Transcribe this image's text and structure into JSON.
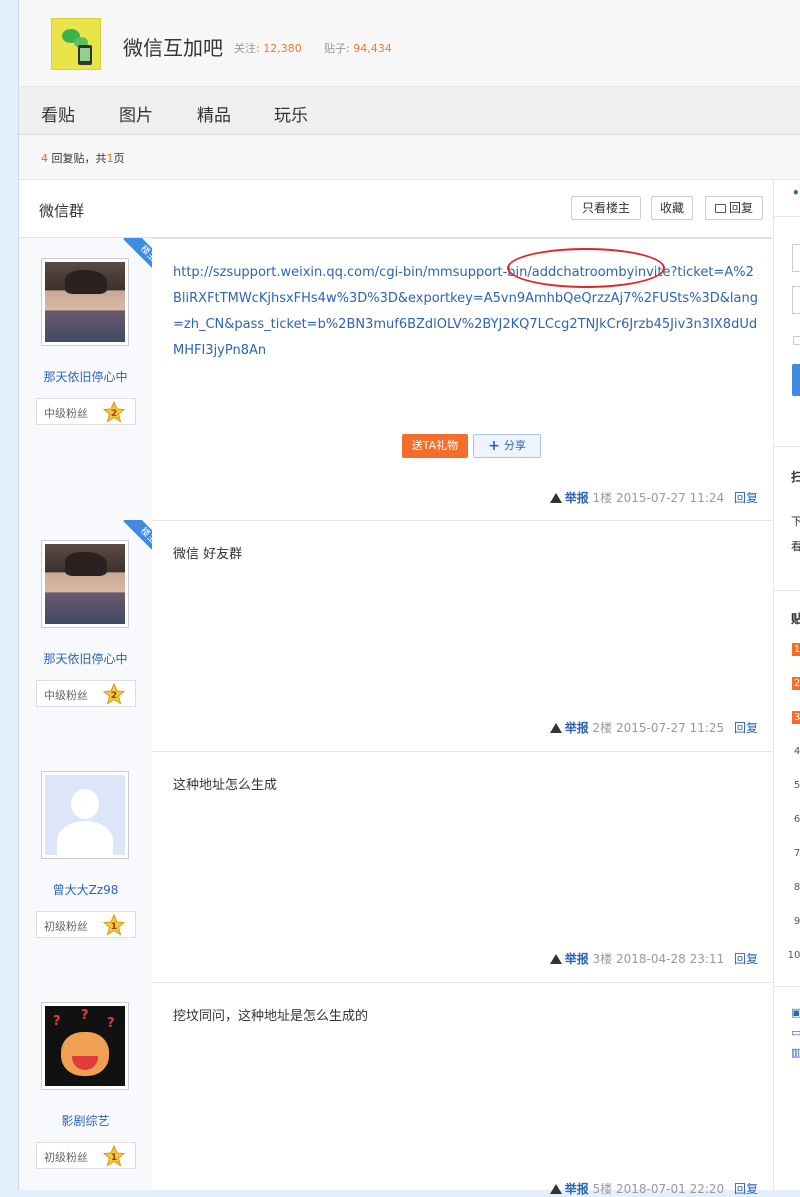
{
  "forum": {
    "name": "微信互加吧",
    "follow_label": "关注:",
    "follow_count": "12,380",
    "posts_label": "贴子:",
    "posts_count": "94,434"
  },
  "nav": [
    "看贴",
    "图片",
    "精品",
    "玩乐"
  ],
  "pager": {
    "replies": "4",
    "replies_text": "回复贴，共",
    "pages": "1",
    "pages_suffix": "页"
  },
  "thread": {
    "title": "微信群",
    "only_owner": "只看楼主",
    "favorite": "收藏",
    "reply": "回复"
  },
  "posts": [
    {
      "username": "那天依旧停心中",
      "fan_level_text": "中级粉丝",
      "level": "2",
      "owner_badge": "楼主",
      "content": "http://szsupport.weixin.qq.com/cgi-bin/mmsupport-bin/addchatroombyinvite?ticket=A%2BliRXFtTMWcKjhsxFHs4w%3D%3D&exportkey=A5vn9AmhbQeQrzzAj7%2FUSts%3D&lang=zh_CN&pass_ticket=b%2BN3muf6BZdlOLV%2BYJ2KQ7LCcg2TNJkCr6Jrzb45Jiv3n3IX8dUdMHFI3jyPn8An",
      "gift": "送TA礼物",
      "share": "分享",
      "report": "举报",
      "floor": "1楼",
      "time": "2015-07-27 11:24",
      "reply": "回复"
    },
    {
      "username": "那天依旧停心中",
      "fan_level_text": "中级粉丝",
      "level": "2",
      "owner_badge": "楼主",
      "content": "微信 好友群",
      "report": "举报",
      "floor": "2楼",
      "time": "2015-07-27 11:25",
      "reply": "回复"
    },
    {
      "username": "曾大大Zz98",
      "fan_level_text": "初级粉丝",
      "level": "1",
      "content": "这种地址怎么生成",
      "report": "举报",
      "floor": "3楼",
      "time": "2018-04-28 23:11",
      "reply": "回复"
    },
    {
      "username": "影剧综艺",
      "fan_level_text": "初级粉丝",
      "level": "1",
      "content": "挖坟同问，这种地址是怎么生成的",
      "report": "举报",
      "floor": "5楼",
      "time": "2018-07-01 22:20",
      "reply": "回复"
    }
  ],
  "rail": {
    "scan_title": "扫",
    "scan_line1": "下",
    "scan_line2": "看",
    "hot_title": "贴",
    "ranks": [
      "1",
      "2",
      "3",
      "4",
      "5",
      "6",
      "7",
      "8",
      "9",
      "10"
    ]
  },
  "colors": {
    "accent": "#2d64b3",
    "orange": "#f46e2b",
    "page_bg": "#e3effc"
  }
}
